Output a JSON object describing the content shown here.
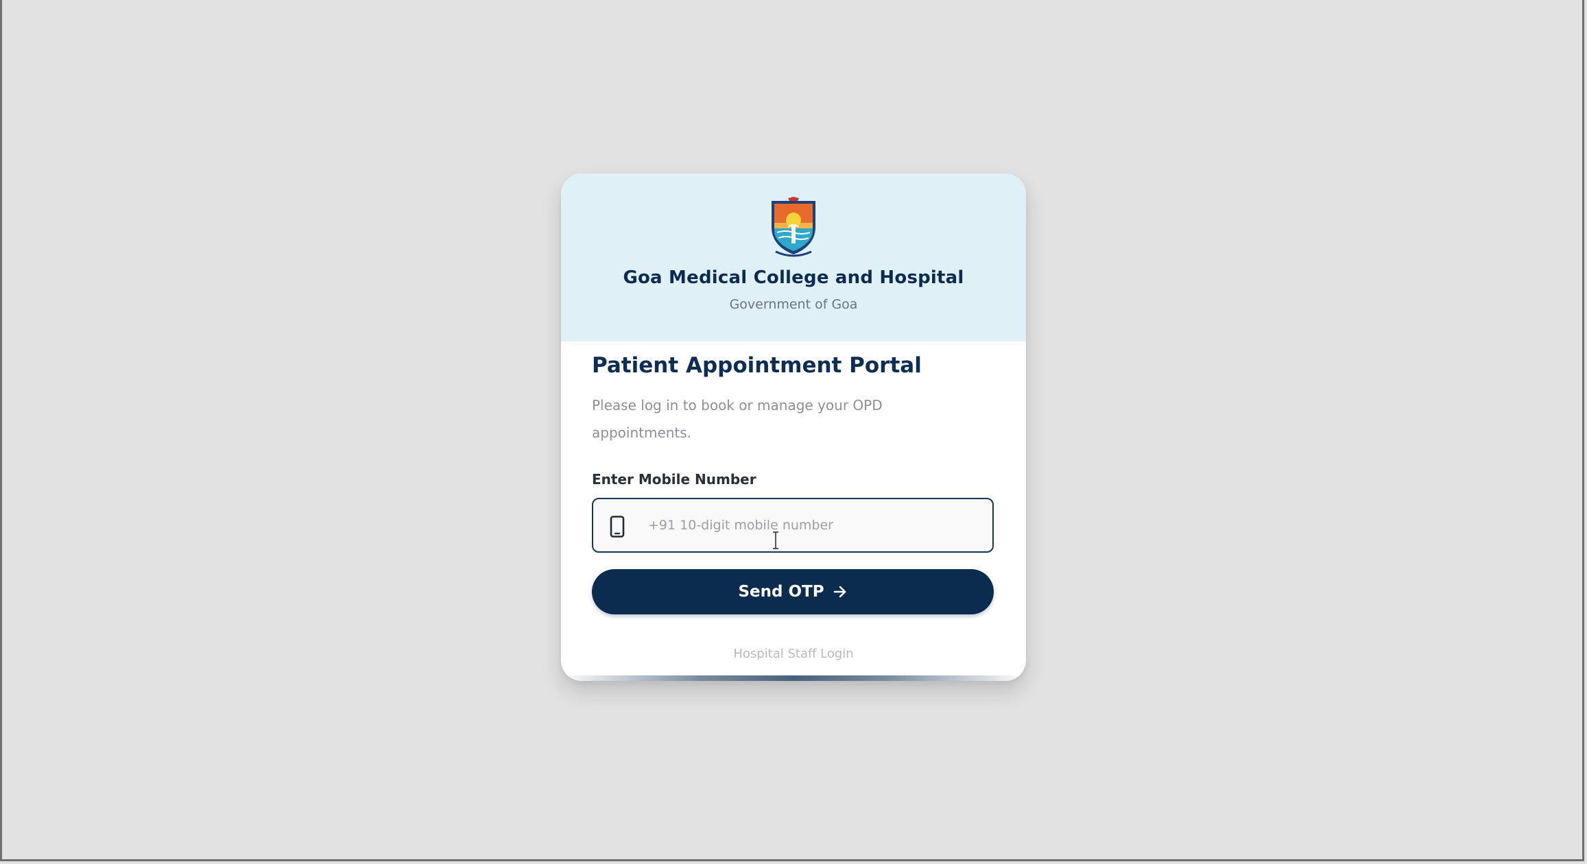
{
  "header": {
    "org_name": "Goa Medical College and Hospital",
    "org_subtitle": "Government of Goa",
    "logo_icon": "gmc-crest-logo"
  },
  "portal": {
    "title": "Patient Appointment Portal",
    "description": "Please log in to book or manage your OPD appointments."
  },
  "mobile_field": {
    "label": "Enter Mobile Number",
    "placeholder": "+91 10-digit mobile number",
    "value": "",
    "icon": "smartphone-icon"
  },
  "actions": {
    "send_otp_label": "Send OTP",
    "send_otp_icon": "arrow-right-icon",
    "staff_login_label": "Hospital Staff Login"
  },
  "colors": {
    "page_background": "#e2e2e2",
    "header_background": "#dff0f6",
    "primary": "#0b2c4f",
    "title_text": "#0e2d52",
    "muted_text": "#8b8f96"
  }
}
